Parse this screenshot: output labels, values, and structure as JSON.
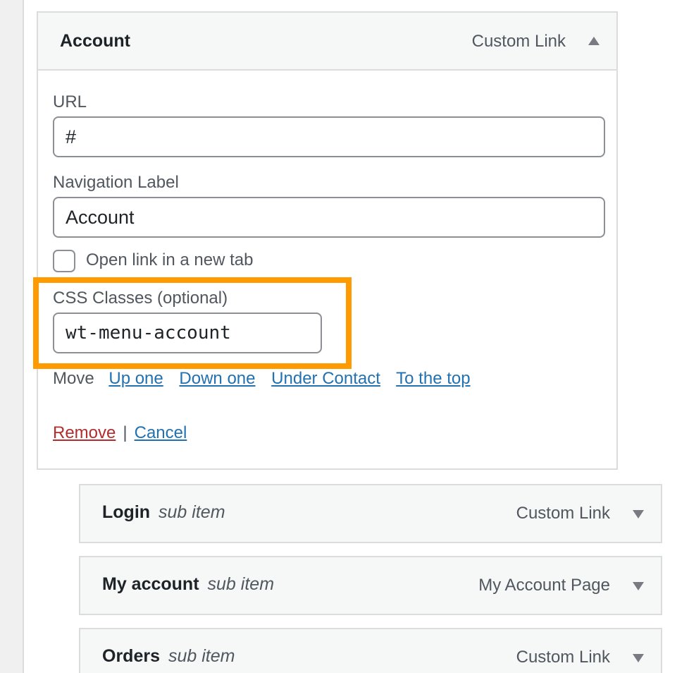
{
  "account_item": {
    "title": "Account",
    "type": "Custom Link",
    "url_label": "URL",
    "url_value": "#",
    "nav_label_label": "Navigation Label",
    "nav_label_value": "Account",
    "new_tab_label": "Open link in a new tab",
    "css_label": "CSS Classes (optional)",
    "css_value": "wt-menu-account",
    "move_label": "Move",
    "move_links": [
      "Up one",
      "Down one",
      "Under Contact",
      "To the top"
    ],
    "remove_label": "Remove",
    "separator": "|",
    "cancel_label": "Cancel"
  },
  "sub_items": [
    {
      "title": "Login",
      "note": "sub item",
      "type": "Custom Link"
    },
    {
      "title": "My account",
      "note": "sub item",
      "type": "My Account Page"
    },
    {
      "title": "Orders",
      "note": "sub item",
      "type": "Custom Link"
    }
  ],
  "colors": {
    "highlight": "#ff9a00",
    "link": "#2271b1",
    "remove": "#b32d2e"
  },
  "icons": {
    "expanded_toggle": "arrow-up-icon",
    "collapsed_toggle": "arrow-down-icon"
  }
}
